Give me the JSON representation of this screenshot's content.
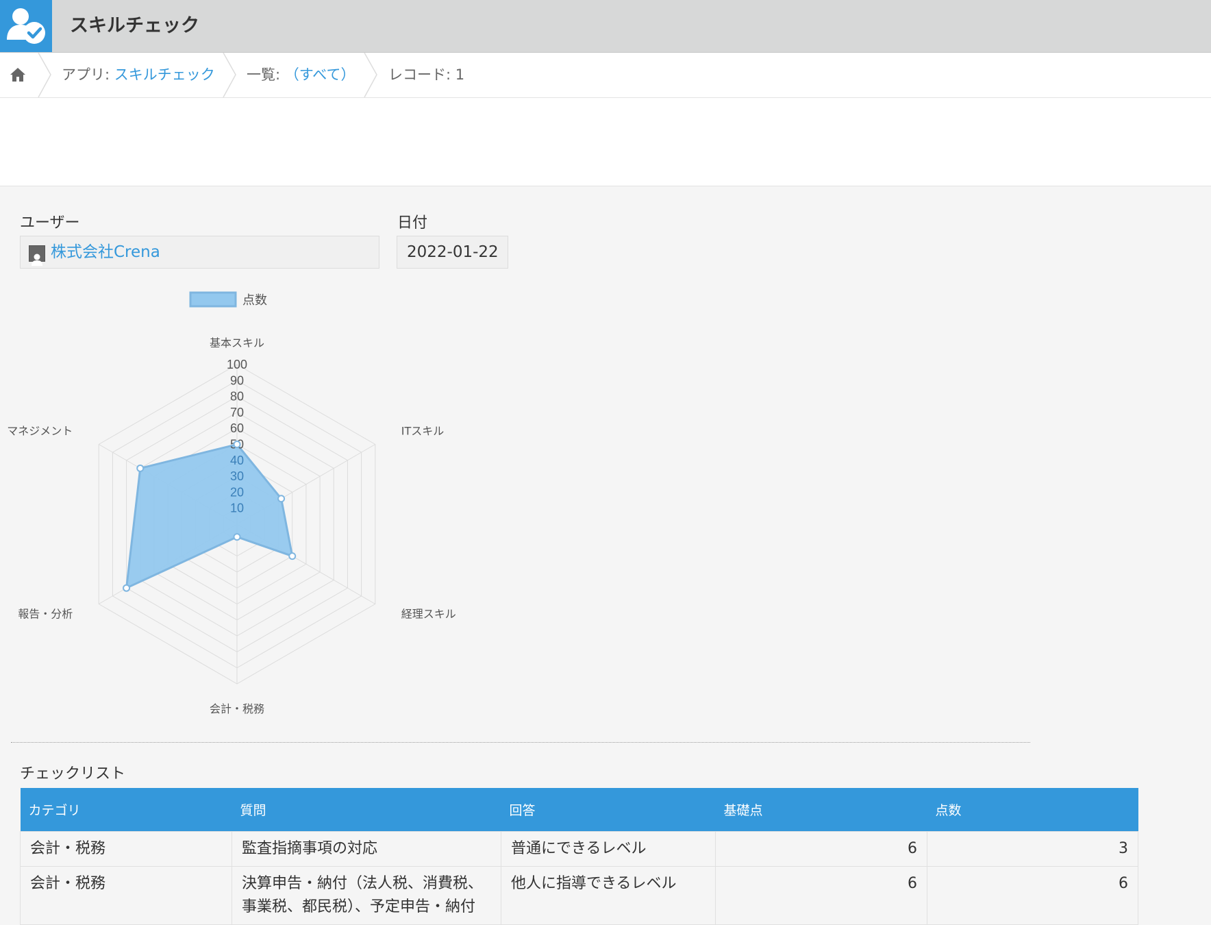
{
  "header": {
    "app_title": "スキルチェック",
    "app_icon": "user-check-icon",
    "accent_color": "#3498db"
  },
  "breadcrumb": {
    "home_icon": "home-icon",
    "app_prefix": "アプリ: ",
    "app_name": "スキルチェック",
    "view_prefix": "一覧: ",
    "view_name": "（すべて）",
    "record_label": "レコード: 1"
  },
  "fields": {
    "user_label": "ユーザー",
    "user_value": "株式会社Crena",
    "date_label": "日付",
    "date_value": "2022-01-22"
  },
  "chart_data": {
    "type": "radar",
    "categories": [
      "基本スキル",
      "ITスキル",
      "経理スキル",
      "会計・税務",
      "報告・分析",
      "マネジメント"
    ],
    "series": [
      {
        "name": "点数",
        "values": [
          50,
          32,
          40,
          8,
          80,
          70
        ]
      }
    ],
    "rlim": [
      0,
      100
    ],
    "ticks": [
      10,
      20,
      30,
      40,
      50,
      60,
      70,
      80,
      90,
      100
    ],
    "legend": "top",
    "grid": true,
    "fill_color": "#93c8ee",
    "stroke_color": "#7fb6e0"
  },
  "checklist": {
    "title": "チェックリスト",
    "columns": [
      "カテゴリ",
      "質問",
      "回答",
      "基礎点",
      "点数"
    ],
    "rows": [
      {
        "category": "会計・税務",
        "question": "監査指摘事項の対応",
        "answer": "普通にできるレベル",
        "base": "6",
        "score": "3"
      },
      {
        "category": "会計・税務",
        "question": "決算申告・納付（法人税、消費税、事業税、都民税）、予定申告・納付",
        "answer": "他人に指導できるレベル",
        "base": "6",
        "score": "6"
      }
    ]
  }
}
